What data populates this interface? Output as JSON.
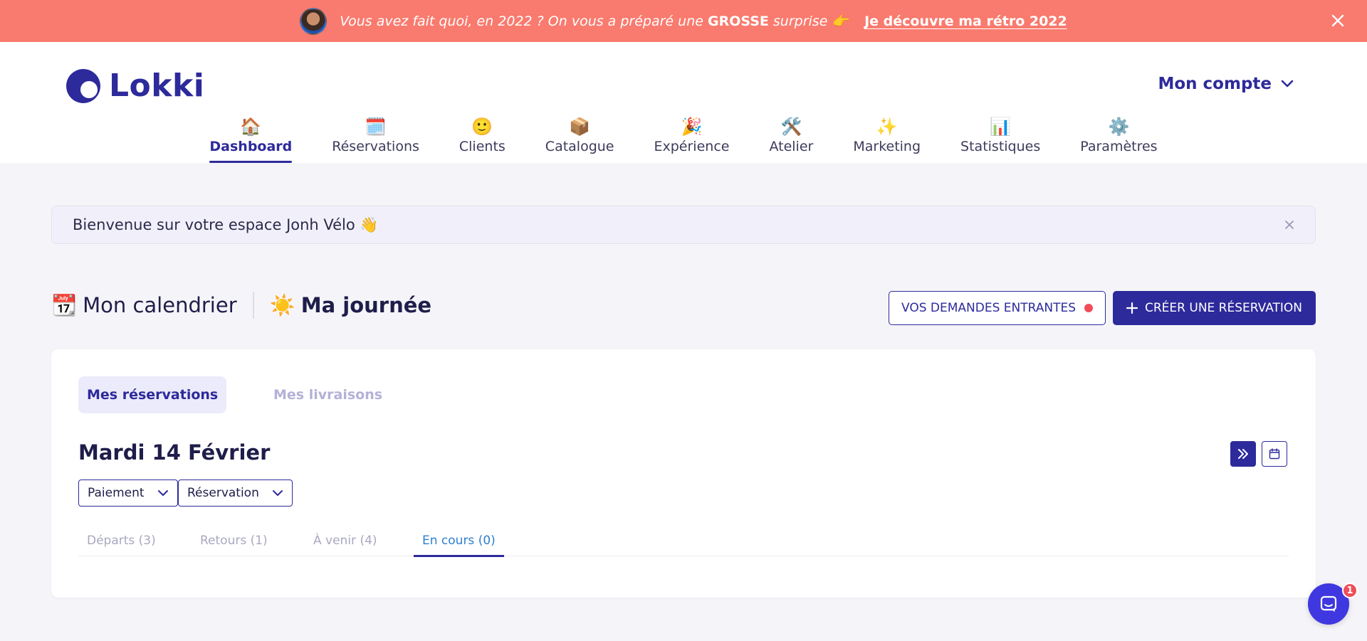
{
  "promo": {
    "text_start": "Vous avez fait quoi, en 2022 ? On vous a préparé une ",
    "text_bold": "GROSSE",
    "text_end": " surprise 👉",
    "link": "Je découvre ma rétro 2022",
    "color": "#f97a6e"
  },
  "header": {
    "logo": "Lokki",
    "account": "Mon compte",
    "brand_color": "#2d2a9b"
  },
  "nav": [
    {
      "icon": "🏠",
      "label": "Dashboard",
      "active": true
    },
    {
      "icon": "🗓️",
      "label": "Réservations"
    },
    {
      "icon": "🙂",
      "label": "Clients"
    },
    {
      "icon": "📦",
      "label": "Catalogue"
    },
    {
      "icon": "🎉",
      "label": "Expérience"
    },
    {
      "icon": "🛠️",
      "label": "Atelier"
    },
    {
      "icon": "✨",
      "label": "Marketing"
    },
    {
      "icon": "📊",
      "label": "Statistiques"
    },
    {
      "icon": "⚙️",
      "label": "Paramètres"
    }
  ],
  "welcome": "Bienvenue sur votre espace Jonh Vélo 👋",
  "section": {
    "calendar_icon": "📆",
    "calendar_label": "Mon calendrier",
    "day_icon": "☀️",
    "day_label": "Ma journée",
    "incoming_button": "VOS DEMANDES ENTRANTES",
    "create_button": "CRÉER UNE RÉSERVATION"
  },
  "card": {
    "tabs": [
      "Mes réservations",
      "Mes livraisons"
    ],
    "date": "Mardi 14 Février",
    "filters": [
      "Paiement",
      "Réservation"
    ],
    "status_tabs": [
      {
        "label": "Départs (3)"
      },
      {
        "label": "Retours (1)"
      },
      {
        "label": "À venir (4)"
      },
      {
        "label": "En cours (0)",
        "active": true
      }
    ]
  },
  "chat": {
    "badge": "1"
  }
}
